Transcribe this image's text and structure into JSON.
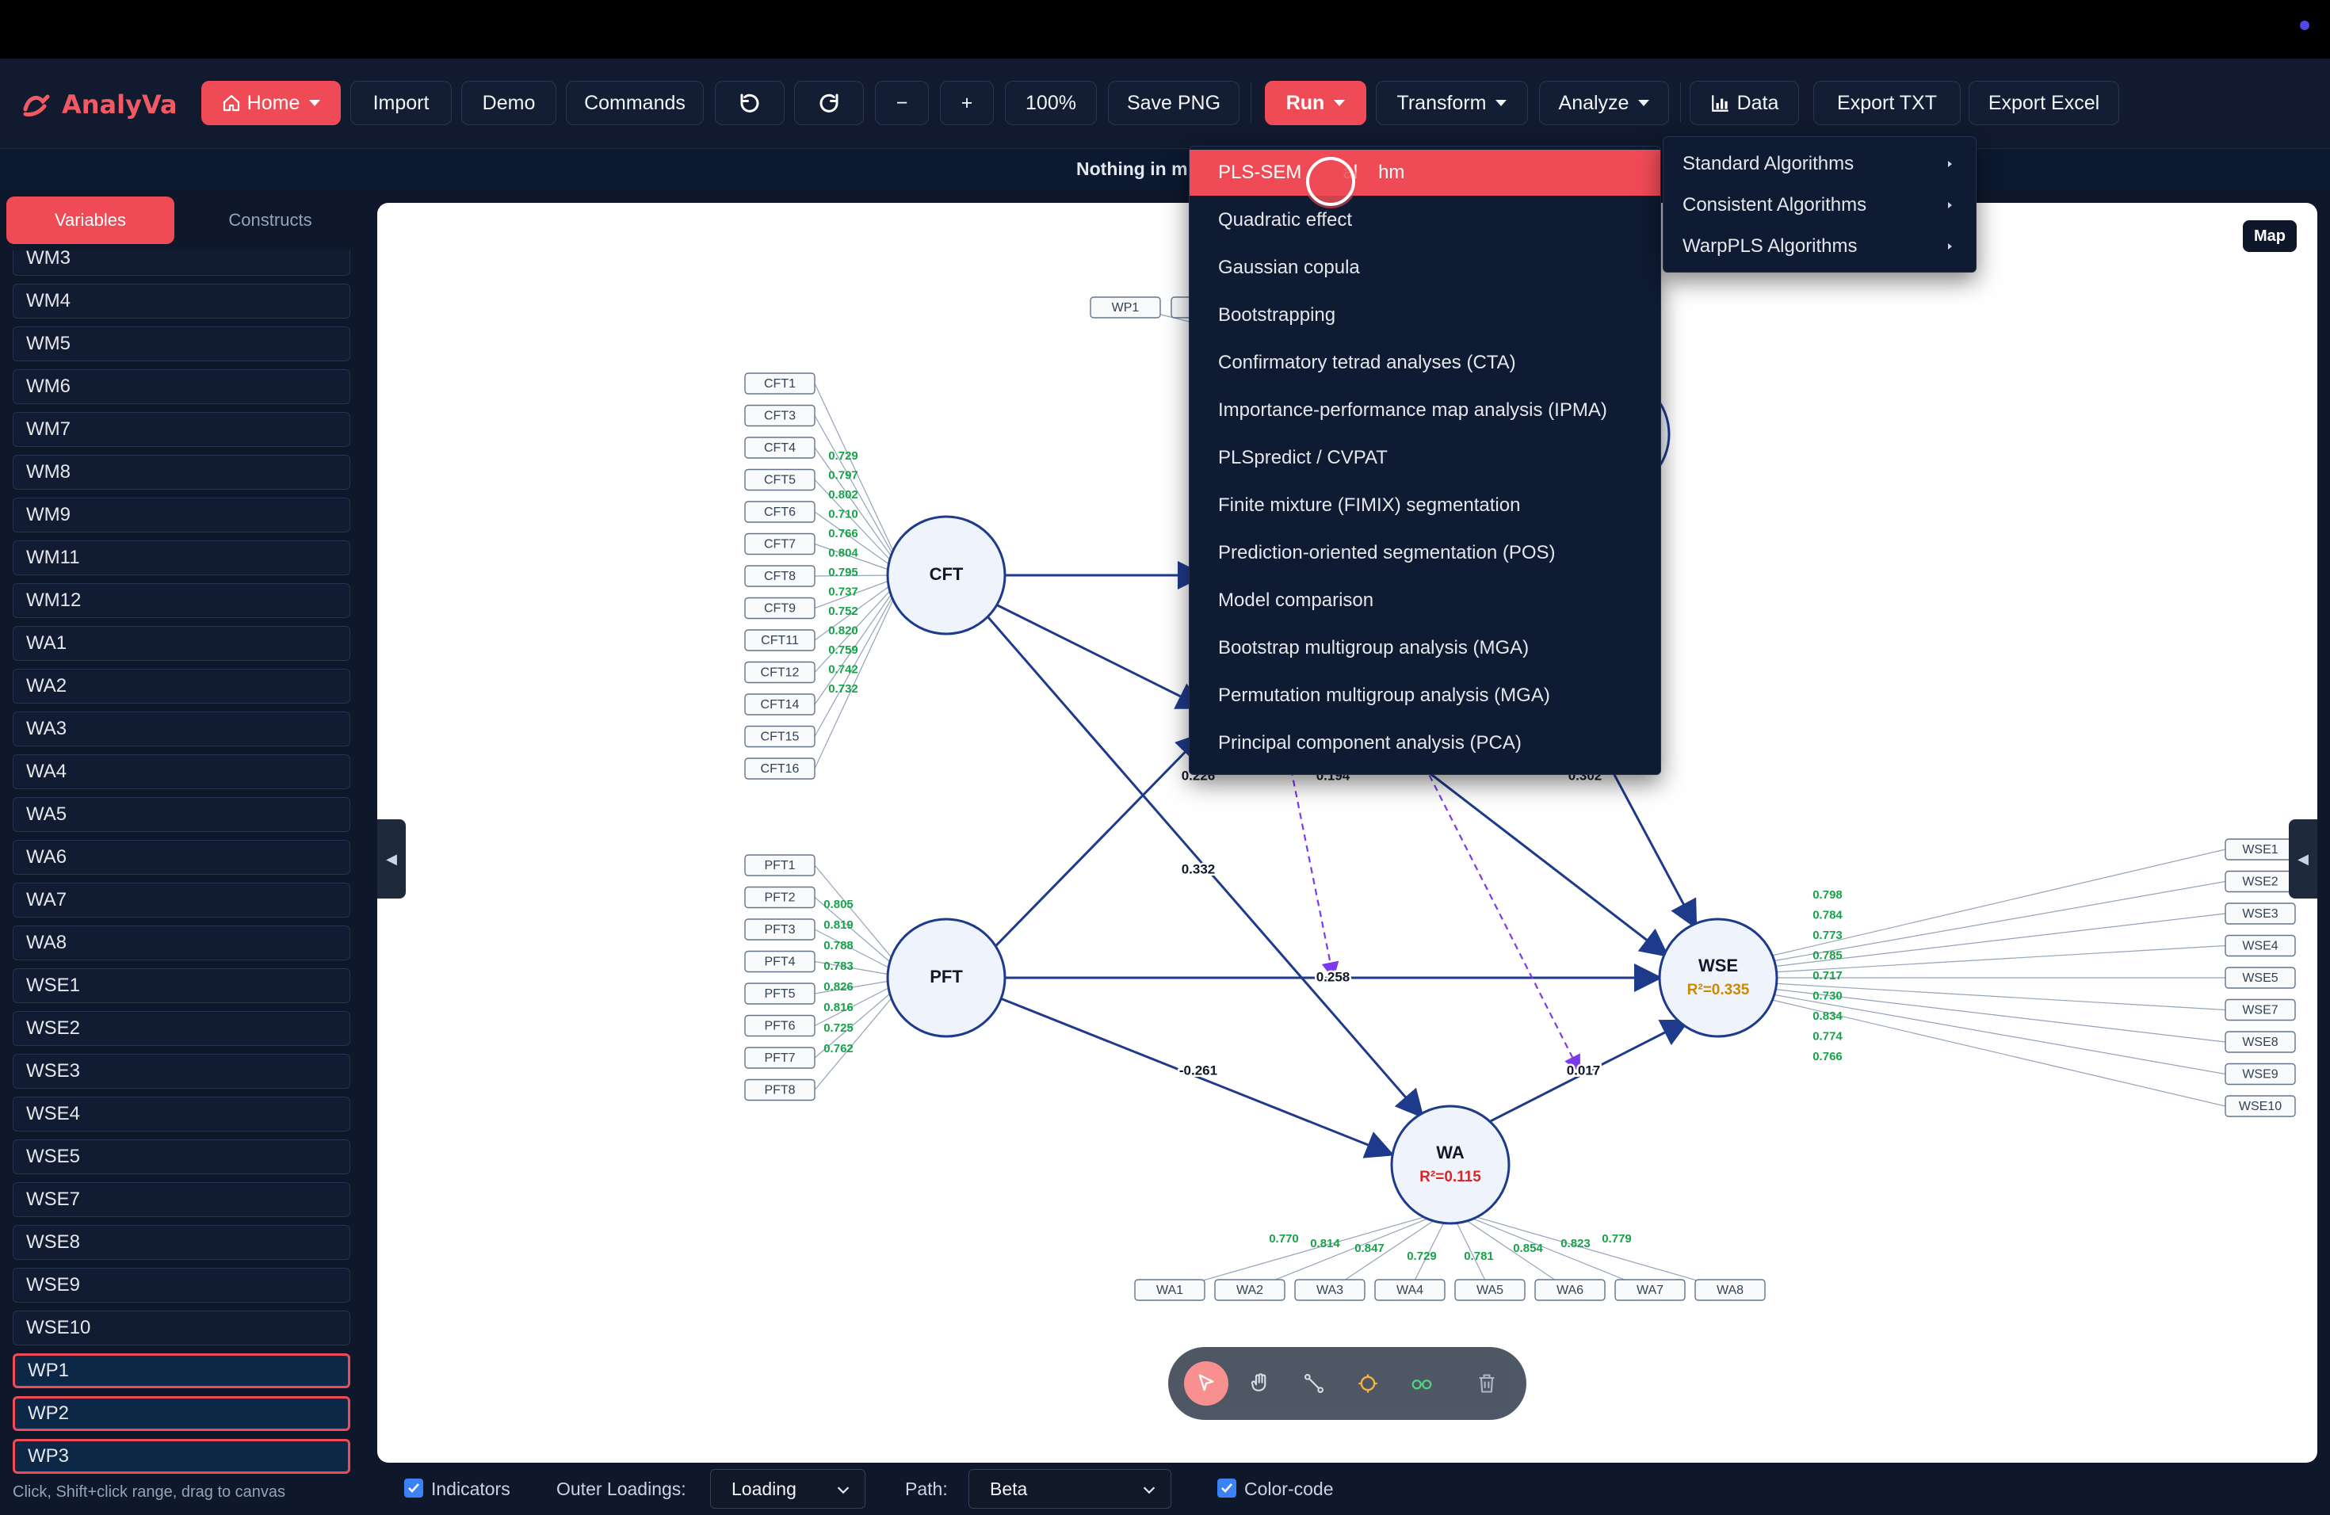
{
  "app": {
    "name_part1": "Analy",
    "name_part2": "Va"
  },
  "toolbar": {
    "home": "Home",
    "import": "Import",
    "demo": "Demo",
    "commands": "Commands",
    "zoom_out": "−",
    "zoom_in": "+",
    "zoom": "100%",
    "save_png": "Save PNG",
    "run": "Run",
    "transform": "Transform",
    "analyze": "Analyze",
    "data": "Data",
    "export_txt": "Export TXT",
    "export_excel": "Export Excel"
  },
  "status": {
    "text": "Nothing in m"
  },
  "sidebar": {
    "tabs": {
      "variables": "Variables",
      "constructs": "Constructs"
    },
    "items": [
      "WM3",
      "WM4",
      "WM5",
      "WM6",
      "WM7",
      "WM8",
      "WM9",
      "WM11",
      "WM12",
      "WA1",
      "WA2",
      "WA3",
      "WA4",
      "WA5",
      "WA6",
      "WA7",
      "WA8",
      "WSE1",
      "WSE2",
      "WSE3",
      "WSE4",
      "WSE5",
      "WSE7",
      "WSE8",
      "WSE9",
      "WSE10",
      "WP1",
      "WP2",
      "WP3"
    ],
    "selected": [
      "WP1",
      "WP2",
      "WP3"
    ],
    "hint": "Click, Shift+click range, drag to canvas"
  },
  "canvas": {
    "map": "Map"
  },
  "run_menu": {
    "items": [
      "PLS-SEM algorithm",
      "Quadratic effect",
      "Gaussian copula",
      "Bootstrapping",
      "Confirmatory tetrad analyses (CTA)",
      "Importance-performance map analysis (IPMA)",
      "PLSpredict / CVPAT",
      "Finite mixture (FIMIX) segmentation",
      "Prediction-oriented segmentation (POS)",
      "Model comparison",
      "Bootstrap multigroup analysis (MGA)",
      "Permutation multigroup analysis (MGA)",
      "Principal component analysis (PCA)"
    ],
    "highlighted_visible_text": {
      "a": "PLS-SEM",
      "b": "al",
      "c": "hm"
    },
    "submenu": [
      "Standard Algorithms",
      "Consistent Algorithms",
      "WarpPLS Algorithms"
    ]
  },
  "model": {
    "constructs": {
      "CFT": {
        "label": "CFT"
      },
      "PFT": {
        "label": "PFT"
      },
      "WSE": {
        "label": "WSE",
        "r2": "R²=0.335"
      },
      "WA": {
        "label": "WA",
        "r2": "R²=0.115"
      }
    },
    "cft_indicators": [
      "CFT1",
      "CFT3",
      "CFT4",
      "CFT5",
      "CFT6",
      "CFT7",
      "CFT8",
      "CFT9",
      "CFT11",
      "CFT12",
      "CFT14",
      "CFT15",
      "CFT16"
    ],
    "cft_loadings": [
      "0.729",
      "0.797",
      "0.802",
      "0.710",
      "0.766",
      "0.804",
      "0.795",
      "0.737",
      "0.752",
      "0.820",
      "0.759",
      "0.742",
      "0.732"
    ],
    "pft_indicators": [
      "PFT1",
      "PFT2",
      "PFT3",
      "PFT4",
      "PFT5",
      "PFT6",
      "PFT7",
      "PFT8"
    ],
    "pft_loadings": [
      "0.805",
      "0.819",
      "0.788",
      "0.783",
      "0.826",
      "0.816",
      "0.725",
      "0.762"
    ],
    "wse_indicators": [
      "WSE1",
      "WSE2",
      "WSE3",
      "WSE4",
      "WSE5",
      "WSE7",
      "WSE8",
      "WSE9",
      "WSE10"
    ],
    "wse_loadings": [
      "0.798",
      "0.784",
      "0.773",
      "0.785",
      "0.717",
      "0.730",
      "0.834",
      "0.774",
      "0.766"
    ],
    "wa_indicators": [
      "WA1",
      "WA2",
      "WA3",
      "WA4",
      "WA5",
      "WA6",
      "WA7",
      "WA8"
    ],
    "wa_loadings": [
      "0.770",
      "0.814",
      "0.847",
      "0.729",
      "0.781",
      "0.854",
      "0.823",
      "0.779"
    ],
    "wp_indicators": [
      "WP1"
    ],
    "paths": {
      "cft_mid": "0",
      "p226": "0.226",
      "p194": "0.194",
      "p302": "0.302",
      "p332": "0.332",
      "p258": "0.258",
      "p261": "-0.261",
      "p017": "0.017"
    }
  },
  "bottom": {
    "indicators": "Indicators",
    "outer_loadings_label": "Outer Loadings:",
    "outer_loadings_value": "Loading",
    "path_label": "Path:",
    "path_value": "Beta",
    "color_code": "Color-code"
  }
}
